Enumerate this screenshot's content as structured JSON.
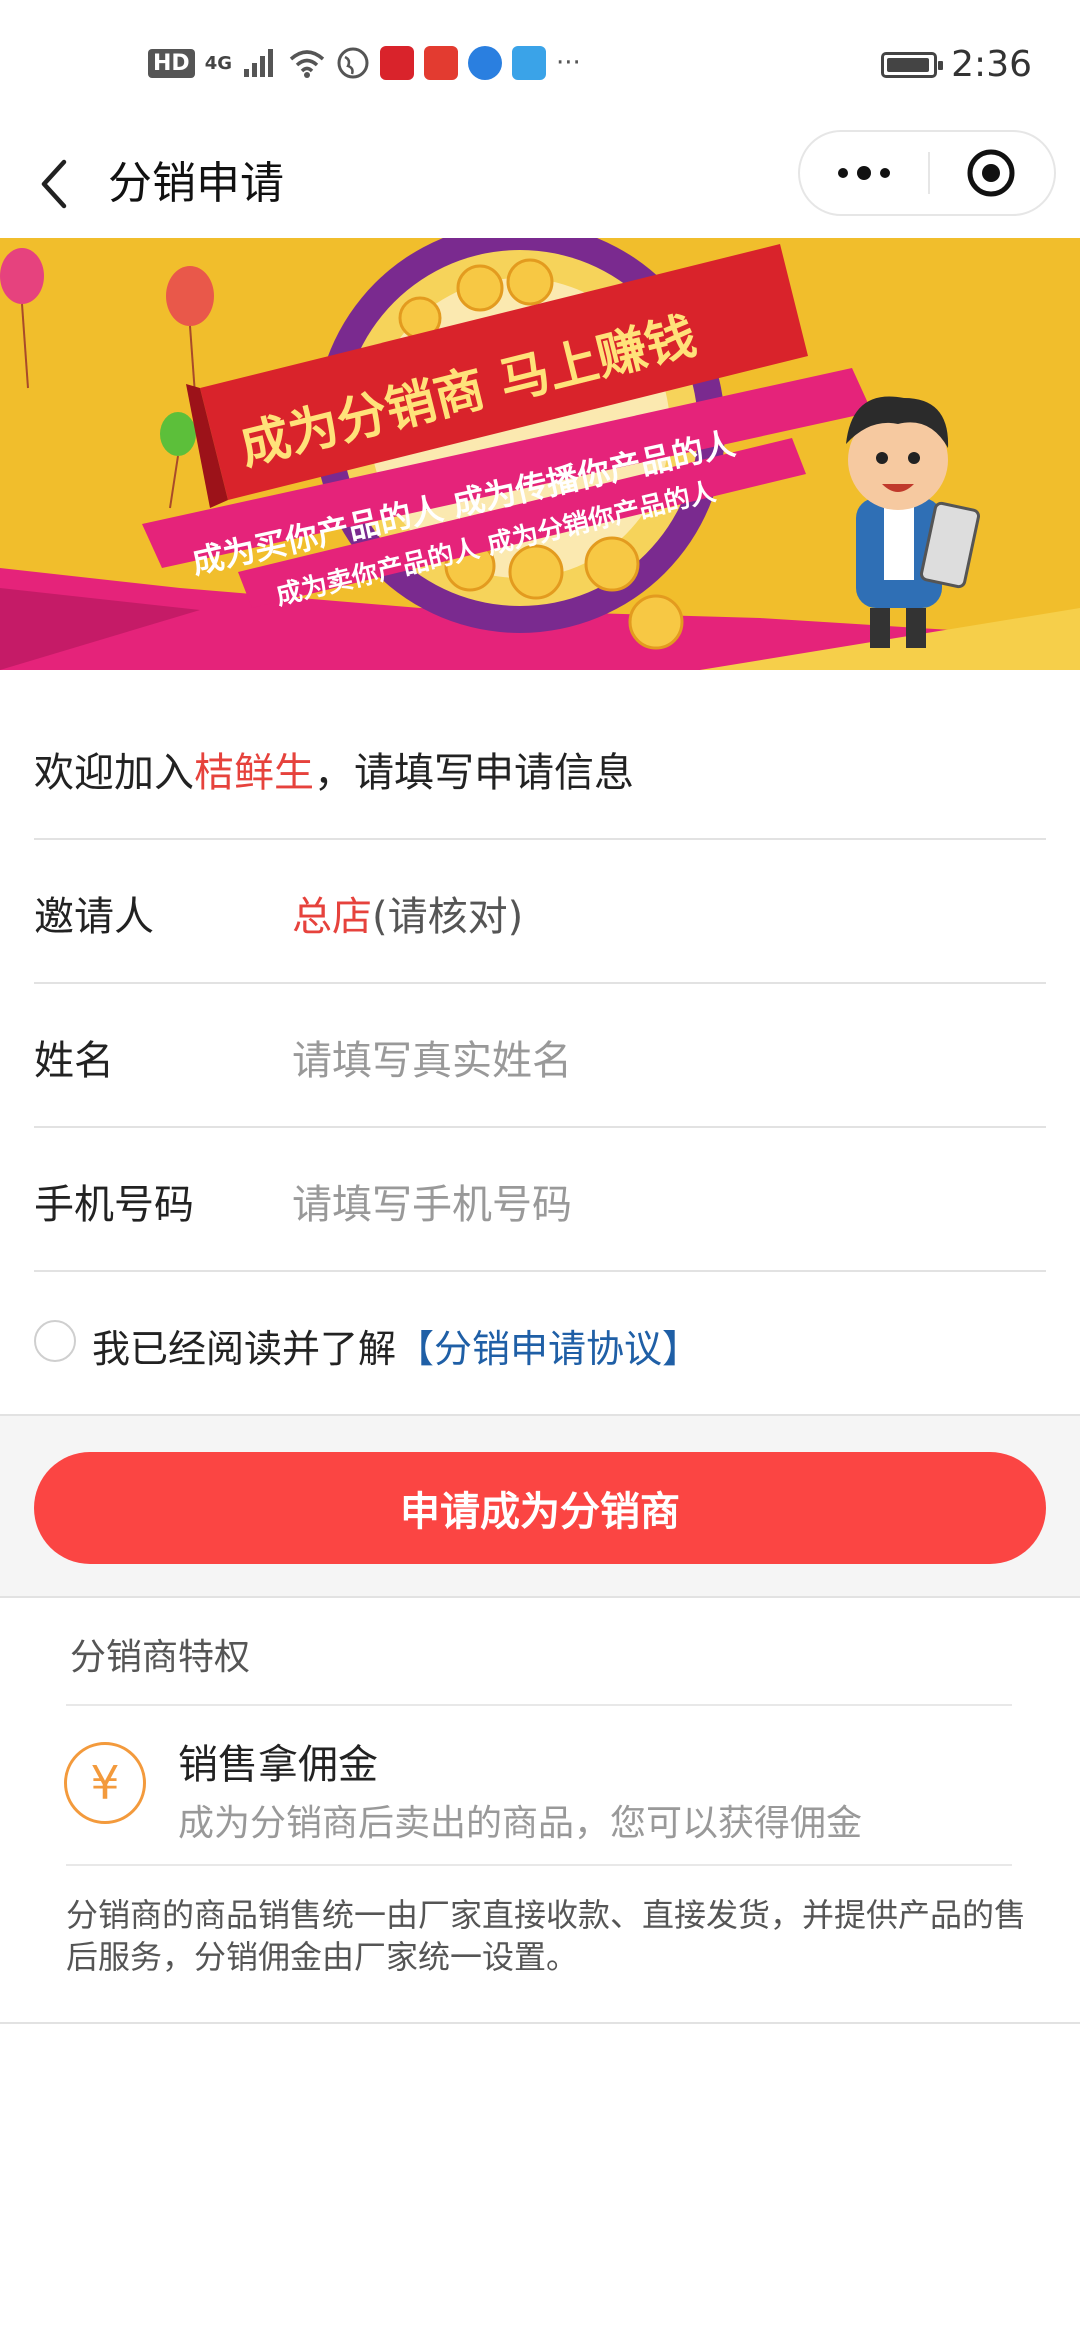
{
  "status_bar": {
    "hd": "HD",
    "network": "4G",
    "time": "2:36",
    "battery_level": 0.95,
    "more": "···"
  },
  "nav": {
    "title": "分销申请"
  },
  "banner": {
    "headline": "成为分销商 马上赚钱",
    "line1": "成为买你产品的人 成为传播你产品的人",
    "line2": "成为卖你产品的人 成为分销你产品的人",
    "colors": {
      "background": "#f1be2c",
      "ribbon_red": "#d9232b",
      "ribbon_pink": "#e5237a",
      "ring_purple": "#7a2a8f"
    }
  },
  "form": {
    "welcome_prefix": "欢迎加入",
    "welcome_brand": "桔鲜生",
    "welcome_suffix": "，请填写申请信息",
    "inviter_label": "邀请人",
    "inviter_name": "总店",
    "inviter_note": "(请核对)",
    "name_label": "姓名",
    "name_placeholder": "请填写真实姓名",
    "phone_label": "手机号码",
    "phone_placeholder": "请填写手机号码",
    "agree_text": "我已经阅读并了解",
    "agree_link": "【分销申请协议】",
    "submit_label": "申请成为分销商"
  },
  "privileges": {
    "title": "分销商特权",
    "item_icon_symbol": "¥",
    "item_title": "销售拿佣金",
    "item_desc": "成为分销商后卖出的商品，您可以获得佣金",
    "note": "分销商的商品销售统一由厂家直接收款、直接发货，并提供产品的售后服务，分销佣金由厂家统一设置。"
  },
  "colors": {
    "accent_red": "#fb4543",
    "brand_red": "#e6423c",
    "link_blue": "#1f5fa6",
    "icon_orange": "#f39a3c"
  }
}
